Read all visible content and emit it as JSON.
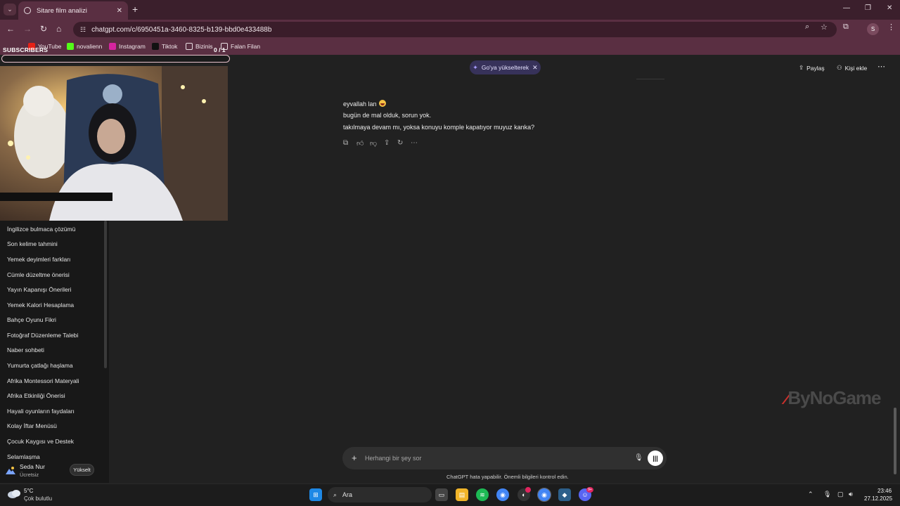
{
  "browser": {
    "tab_title": "Sitare film analizi",
    "url": "chatgpt.com/c/6950451a-3460-8325-b139-bbd0e433488b",
    "profile_initial": "S",
    "bookmarks": [
      "YouTube",
      "novalienn",
      "Instagram",
      "Tiktok",
      "Bizinis",
      "Falan Filan"
    ]
  },
  "overlay": {
    "subscribers_label": "SUBSCRIBERS",
    "subscribers_count": "0",
    "subscribers_total": "1"
  },
  "sidebar": {
    "conversations": [
      "İngilizce bulmaca çözümü",
      "Son kelime tahmini",
      "Yemek deyimleri farkları",
      "Cümle düzeltme önerisi",
      "Yayın Kapanışı Önerileri",
      "Yemek Kalori Hesaplama",
      "Bahçe Oyunu Fikri",
      "Fotoğraf Düzenleme Talebi",
      "Naber sohbeti",
      "Yumurta çatlağı haşlama",
      "Afrika Montessori Materyali",
      "Afrika Etkinliği Önerisi",
      "Hayali oyunların faydaları",
      "Kolay İftar Menüsü",
      "Çocuk Kaygısı ve Destek",
      "Selamlaşma"
    ],
    "user": {
      "name": "Seda Nur",
      "plan": "Ücretsiz",
      "upgrade_label": "Yükselt"
    }
  },
  "header": {
    "upgrade_pill": "Go'ya yükselterek",
    "share_label": "Paylaş",
    "add_person_label": "Kişi ekle"
  },
  "chat": {
    "lines": [
      "eyvallah lan",
      "bugün de mal olduk, sorun yok.",
      "takılmaya devam mı, yoksa konuyu komple kapatıyor muyuz kanka?"
    ]
  },
  "composer": {
    "placeholder": "Herhangi bir şey sor",
    "disclaimer": "ChatGPT hata yapabilir. Önemli bilgileri kontrol edin."
  },
  "watermark": "ByNoGame",
  "taskbar": {
    "weather_temp": "5°C",
    "weather_desc": "Çok bulutlu",
    "search_label": "Ara",
    "time": "23:46",
    "date": "27.12.2025",
    "discord_badge": "9+"
  }
}
